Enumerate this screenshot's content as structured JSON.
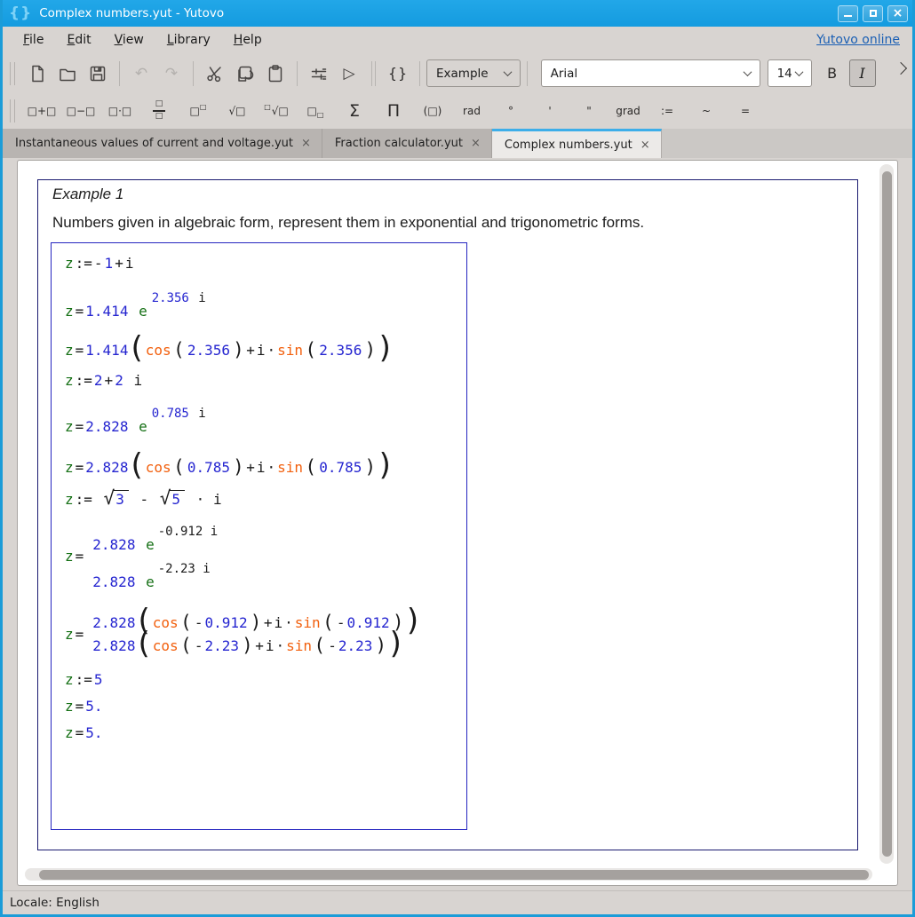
{
  "window": {
    "title": "Complex numbers.yut - Yutovo",
    "logo": "{}"
  },
  "window_controls": {
    "close_glyph": "×"
  },
  "menubar": {
    "items": [
      "File",
      "Edit",
      "View",
      "Library",
      "Help"
    ],
    "online_link": "Yutovo online"
  },
  "toolbar_main": {
    "icons": [
      "new-file",
      "open-folder",
      "save",
      "undo",
      "redo",
      "cut",
      "copy",
      "paste",
      "adjust",
      "run",
      "braces"
    ],
    "braces_label": "{}",
    "run_glyph": "▷",
    "undo_glyph": "↶",
    "redo_glyph": "↷",
    "example_dropdown": "Example",
    "font_family": "Arial",
    "font_size": "14",
    "bold": "B",
    "italic": "I"
  },
  "toolbar_math": {
    "items": [
      {
        "id": "plus",
        "label": "□+□"
      },
      {
        "id": "minus",
        "label": "□−□"
      },
      {
        "id": "times",
        "label": "□·□"
      },
      {
        "id": "fraction",
        "stack": [
          "□",
          "□"
        ]
      },
      {
        "id": "power",
        "base": "□",
        "sup": "□"
      },
      {
        "id": "sqrt",
        "label": "√□"
      },
      {
        "id": "nthroot",
        "presup": "□",
        "label": "√□"
      },
      {
        "id": "subscript",
        "base": "□",
        "sub": "□"
      },
      {
        "id": "sum",
        "label": "Σ",
        "big": true
      },
      {
        "id": "product",
        "label": "Π",
        "big": true
      },
      {
        "id": "parens",
        "label": "(□)"
      },
      {
        "id": "rad",
        "label": "rad"
      },
      {
        "id": "degree",
        "label": "°"
      },
      {
        "id": "minute",
        "label": "'"
      },
      {
        "id": "second",
        "label": "\""
      },
      {
        "id": "grad",
        "label": "grad"
      },
      {
        "id": "assign",
        "label": ":="
      },
      {
        "id": "tilde",
        "label": "~"
      },
      {
        "id": "equals",
        "label": "="
      }
    ]
  },
  "tabs": [
    {
      "label": "Instantaneous values of current and voltage.yut",
      "close": "×",
      "active": false
    },
    {
      "label": "Fraction calculator.yut",
      "close": "×",
      "active": false
    },
    {
      "label": "Complex numbers.yut",
      "close": "×",
      "active": true
    }
  ],
  "document": {
    "heading": "Example 1",
    "description": "Numbers given in algebraic form, represent them in exponential and trigonometric forms.",
    "math_lines": [
      {
        "mt": 4,
        "segs": [
          [
            "v",
            "z"
          ],
          [
            "o",
            ":="
          ],
          [
            "o",
            "-"
          ],
          [
            "n",
            "1"
          ],
          [
            "o",
            "+"
          ],
          [
            "o",
            "i"
          ]
        ]
      },
      {
        "mt": 10,
        "pad": true,
        "segs": [
          [
            "v",
            "z"
          ],
          [
            "o",
            "="
          ],
          [
            "n",
            "1.414"
          ],
          [
            "v",
            " e"
          ],
          [
            "sup",
            [
              [
                "n",
                "2.356"
              ],
              [
                "o",
                " i"
              ]
            ]
          ]
        ]
      },
      {
        "mt": 20,
        "segs": [
          [
            "v",
            "z"
          ],
          [
            "o",
            "="
          ],
          [
            "n",
            "1.414"
          ],
          [
            "bp",
            "("
          ],
          [
            "f",
            "cos"
          ],
          [
            "mp",
            "("
          ],
          [
            "n",
            "2.356"
          ],
          [
            "mp",
            ")"
          ],
          [
            "o",
            "+"
          ],
          [
            "o",
            "i"
          ],
          [
            "o",
            "·"
          ],
          [
            "f",
            "sin"
          ],
          [
            "mp",
            "("
          ],
          [
            "n",
            "2.356"
          ],
          [
            "mp",
            ")"
          ],
          [
            "bp",
            ")"
          ]
        ]
      },
      {
        "mt": 10,
        "segs": [
          [
            "v",
            "z"
          ],
          [
            "o",
            ":="
          ],
          [
            "n",
            "2"
          ],
          [
            "o",
            "+"
          ],
          [
            "n",
            "2"
          ],
          [
            "o",
            " i"
          ]
        ]
      },
      {
        "mt": 8,
        "pad": true,
        "segs": [
          [
            "v",
            "z"
          ],
          [
            "o",
            "="
          ],
          [
            "n",
            "2.828"
          ],
          [
            "v",
            " e"
          ],
          [
            "sup",
            [
              [
                "n",
                "0.785"
              ],
              [
                "o",
                " i"
              ]
            ]
          ]
        ]
      },
      {
        "mt": 22,
        "segs": [
          [
            "v",
            "z"
          ],
          [
            "o",
            "="
          ],
          [
            "n",
            "2.828"
          ],
          [
            "bp",
            "("
          ],
          [
            "f",
            "cos"
          ],
          [
            "mp",
            "("
          ],
          [
            "n",
            "0.785"
          ],
          [
            "mp",
            ")"
          ],
          [
            "o",
            "+"
          ],
          [
            "o",
            "i"
          ],
          [
            "o",
            "·"
          ],
          [
            "f",
            "sin"
          ],
          [
            "mp",
            "("
          ],
          [
            "n",
            "0.785"
          ],
          [
            "mp",
            ")"
          ],
          [
            "bp",
            ")"
          ]
        ]
      },
      {
        "mt": 12,
        "segs": [
          [
            "v",
            "z"
          ],
          [
            "o",
            ":= "
          ],
          [
            "sqrt",
            "3"
          ],
          [
            "o",
            " - "
          ],
          [
            "sqrt",
            "5"
          ],
          [
            "o",
            " · i"
          ]
        ]
      },
      {
        "mt": 10,
        "type": "stack",
        "lead": [
          [
            "v",
            "z"
          ],
          [
            "o",
            "="
          ]
        ],
        "rows": [
          {
            "pad": true,
            "segs": [
              [
                "n",
                "2.828"
              ],
              [
                "v",
                " e"
              ],
              [
                "sup",
                [
                  [
                    "d",
                    "-0.912"
                  ],
                  [
                    "d",
                    " i"
                  ]
                ]
              ]
            ]
          },
          {
            "pad": true,
            "segs": [
              [
                "n",
                "2.828"
              ],
              [
                "v",
                " e"
              ],
              [
                "sup",
                [
                  [
                    "d",
                    "-2.23"
                  ],
                  [
                    "d",
                    " i"
                  ]
                ]
              ]
            ]
          }
        ]
      },
      {
        "mt": 20,
        "type": "stack",
        "lead": [
          [
            "v",
            "z"
          ],
          [
            "o",
            "="
          ]
        ],
        "rows": [
          {
            "segs": [
              [
                "n",
                "2.828"
              ],
              [
                "bp",
                "("
              ],
              [
                "f",
                "cos"
              ],
              [
                "mp",
                "("
              ],
              [
                "o",
                "-"
              ],
              [
                "n",
                "0.912"
              ],
              [
                "mp",
                ")"
              ],
              [
                "o",
                "+"
              ],
              [
                "o",
                "i"
              ],
              [
                "o",
                "·"
              ],
              [
                "f",
                "sin"
              ],
              [
                "mp",
                "("
              ],
              [
                "o",
                "-"
              ],
              [
                "n",
                "0.912"
              ],
              [
                "mp",
                ")"
              ],
              [
                "bp",
                ")"
              ]
            ]
          },
          {
            "segs": [
              [
                "n",
                "2.828"
              ],
              [
                "bp",
                "("
              ],
              [
                "f",
                "cos"
              ],
              [
                "mp",
                "("
              ],
              [
                "o",
                "-"
              ],
              [
                "n",
                "2.23"
              ],
              [
                "mp",
                ")"
              ],
              [
                "o",
                "+"
              ],
              [
                "o",
                "i"
              ],
              [
                "o",
                "·"
              ],
              [
                "f",
                "sin"
              ],
              [
                "mp",
                "("
              ],
              [
                "o",
                "-"
              ],
              [
                "n",
                "2.23"
              ],
              [
                "mp",
                ")"
              ],
              [
                "bp",
                ")"
              ]
            ]
          }
        ]
      },
      {
        "mt": 13,
        "segs": [
          [
            "v",
            "z"
          ],
          [
            "o",
            ":="
          ],
          [
            "n",
            "5"
          ]
        ]
      },
      {
        "mt": 6,
        "segs": [
          [
            "v",
            "z"
          ],
          [
            "o",
            "="
          ],
          [
            "n",
            "5."
          ]
        ]
      },
      {
        "mt": 6,
        "segs": [
          [
            "v",
            "z"
          ],
          [
            "o",
            "="
          ],
          [
            "n",
            "5."
          ]
        ]
      }
    ]
  },
  "statusbar": {
    "locale": "Locale: English"
  },
  "colors": {
    "titlebar": "#18a0e4",
    "accent": "#3daee9",
    "var_green": "#157015",
    "num_blue": "#2525d0",
    "fn_orange": "#f2600e",
    "page_border": "#1a1a70",
    "box_border": "#2525c0"
  }
}
